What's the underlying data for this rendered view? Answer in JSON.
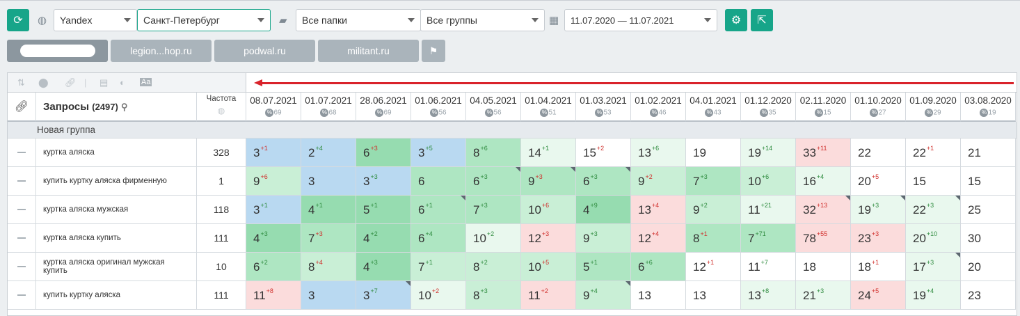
{
  "toolbar": {
    "engine": "Yandex",
    "region": "Санкт-Петербург",
    "folders": "Все папки",
    "groups": "Все группы",
    "date_range": "11.07.2020 — 11.07.2021"
  },
  "tabs": [
    "legion...hop.ru",
    "podwal.ru",
    "militant.ru"
  ],
  "table": {
    "title": "Запросы",
    "count": "(2497)",
    "freq_header": "Частота",
    "group_name": "Новая группа",
    "dates": [
      {
        "date": "08.07.2021",
        "pct": "69"
      },
      {
        "date": "01.07.2021",
        "pct": "68"
      },
      {
        "date": "28.06.2021",
        "pct": "69"
      },
      {
        "date": "01.06.2021",
        "pct": "56"
      },
      {
        "date": "04.05.2021",
        "pct": "56"
      },
      {
        "date": "01.04.2021",
        "pct": "51"
      },
      {
        "date": "01.03.2021",
        "pct": "53"
      },
      {
        "date": "01.02.2021",
        "pct": "46"
      },
      {
        "date": "04.01.2021",
        "pct": "43"
      },
      {
        "date": "01.12.2020",
        "pct": "35"
      },
      {
        "date": "02.11.2020",
        "pct": "15"
      },
      {
        "date": "01.10.2020",
        "pct": "27"
      },
      {
        "date": "01.09.2020",
        "pct": "29"
      },
      {
        "date": "03.08.2020",
        "pct": "19"
      }
    ],
    "rows": [
      {
        "query": "куртка аляска",
        "freq": "328",
        "cells": [
          {
            "v": "3",
            "d": "+1",
            "t": "dn",
            "bg": "#b9d9f1"
          },
          {
            "v": "2",
            "d": "+4",
            "t": "up",
            "bg": "#b9d9f1"
          },
          {
            "v": "6",
            "d": "+3",
            "t": "dn",
            "bg": "#96dcb0"
          },
          {
            "v": "3",
            "d": "+5",
            "t": "up",
            "bg": "#b9d9f1"
          },
          {
            "v": "8",
            "d": "+6",
            "t": "up",
            "bg": "#aee6c2"
          },
          {
            "v": "14",
            "d": "+1",
            "t": "up",
            "bg": "#e9f8ee"
          },
          {
            "v": "15",
            "d": "+2",
            "t": "dn",
            "bg": "#ffffff"
          },
          {
            "v": "13",
            "d": "+6",
            "t": "up",
            "bg": "#e9f8ee"
          },
          {
            "v": "19",
            "d": "",
            "t": "",
            "bg": "#ffffff"
          },
          {
            "v": "19",
            "d": "+14",
            "t": "up",
            "bg": "#e9f8ee"
          },
          {
            "v": "33",
            "d": "+11",
            "t": "dn",
            "bg": "#fbdcdc"
          },
          {
            "v": "22",
            "d": "",
            "t": "",
            "bg": "#ffffff"
          },
          {
            "v": "22",
            "d": "+1",
            "t": "dn",
            "bg": "#ffffff"
          },
          {
            "v": "21",
            "d": "",
            "t": "",
            "bg": "#ffffff"
          }
        ]
      },
      {
        "query": "купить куртку аляска фирменную",
        "freq": "1",
        "cells": [
          {
            "v": "9",
            "d": "+6",
            "t": "dn",
            "bg": "#c9efd6"
          },
          {
            "v": "3",
            "d": "",
            "t": "",
            "bg": "#b9d9f1"
          },
          {
            "v": "3",
            "d": "+3",
            "t": "up",
            "bg": "#b9d9f1"
          },
          {
            "v": "6",
            "d": "",
            "t": "",
            "bg": "#aee6c2"
          },
          {
            "v": "6",
            "d": "+3",
            "t": "up",
            "bg": "#aee6c2",
            "k": 1
          },
          {
            "v": "9",
            "d": "+3",
            "t": "dn",
            "bg": "#aee6c2",
            "k": 1
          },
          {
            "v": "6",
            "d": "+3",
            "t": "up",
            "bg": "#aee6c2",
            "k": 1
          },
          {
            "v": "9",
            "d": "+2",
            "t": "dn",
            "bg": "#c9efd6"
          },
          {
            "v": "7",
            "d": "+3",
            "t": "up",
            "bg": "#aee6c2"
          },
          {
            "v": "10",
            "d": "+6",
            "t": "up",
            "bg": "#c9efd6"
          },
          {
            "v": "16",
            "d": "+4",
            "t": "up",
            "bg": "#e9f8ee"
          },
          {
            "v": "20",
            "d": "+5",
            "t": "dn",
            "bg": "#ffffff"
          },
          {
            "v": "15",
            "d": "",
            "t": "",
            "bg": "#ffffff"
          },
          {
            "v": "15",
            "d": "",
            "t": "",
            "bg": "#ffffff"
          }
        ]
      },
      {
        "query": "куртка аляска мужская",
        "freq": "118",
        "cells": [
          {
            "v": "3",
            "d": "+1",
            "t": "up",
            "bg": "#b9d9f1"
          },
          {
            "v": "4",
            "d": "+1",
            "t": "up",
            "bg": "#96dcb0"
          },
          {
            "v": "5",
            "d": "+1",
            "t": "up",
            "bg": "#96dcb0"
          },
          {
            "v": "6",
            "d": "+1",
            "t": "up",
            "bg": "#aee6c2",
            "k": 1
          },
          {
            "v": "7",
            "d": "+3",
            "t": "up",
            "bg": "#aee6c2"
          },
          {
            "v": "10",
            "d": "+6",
            "t": "dn",
            "bg": "#c9efd6"
          },
          {
            "v": "4",
            "d": "+9",
            "t": "up",
            "bg": "#96dcb0"
          },
          {
            "v": "13",
            "d": "+4",
            "t": "dn",
            "bg": "#fbdcdc"
          },
          {
            "v": "9",
            "d": "+2",
            "t": "up",
            "bg": "#c9efd6"
          },
          {
            "v": "11",
            "d": "+21",
            "t": "up",
            "bg": "#e9f8ee"
          },
          {
            "v": "32",
            "d": "+13",
            "t": "dn",
            "bg": "#fbdcdc",
            "k": 1
          },
          {
            "v": "19",
            "d": "+3",
            "t": "up",
            "bg": "#e9f8ee",
            "k": 1
          },
          {
            "v": "22",
            "d": "+3",
            "t": "up",
            "bg": "#e9f8ee",
            "k": 1
          },
          {
            "v": "25",
            "d": "",
            "t": "",
            "bg": "#ffffff"
          }
        ]
      },
      {
        "query": "куртка аляска купить",
        "freq": "111",
        "cells": [
          {
            "v": "4",
            "d": "+3",
            "t": "up",
            "bg": "#96dcb0"
          },
          {
            "v": "7",
            "d": "+3",
            "t": "dn",
            "bg": "#aee6c2"
          },
          {
            "v": "4",
            "d": "+2",
            "t": "up",
            "bg": "#96dcb0"
          },
          {
            "v": "6",
            "d": "+4",
            "t": "up",
            "bg": "#aee6c2"
          },
          {
            "v": "10",
            "d": "+2",
            "t": "up",
            "bg": "#e9f8ee"
          },
          {
            "v": "12",
            "d": "+3",
            "t": "dn",
            "bg": "#fbdcdc"
          },
          {
            "v": "9",
            "d": "+3",
            "t": "up",
            "bg": "#c9efd6"
          },
          {
            "v": "12",
            "d": "+4",
            "t": "dn",
            "bg": "#fbdcdc"
          },
          {
            "v": "8",
            "d": "+1",
            "t": "dn",
            "bg": "#aee6c2"
          },
          {
            "v": "7",
            "d": "+71",
            "t": "up",
            "bg": "#aee6c2"
          },
          {
            "v": "78",
            "d": "+55",
            "t": "dn",
            "bg": "#fbdcdc"
          },
          {
            "v": "23",
            "d": "+3",
            "t": "dn",
            "bg": "#fbdcdc"
          },
          {
            "v": "20",
            "d": "+10",
            "t": "up",
            "bg": "#e9f8ee"
          },
          {
            "v": "30",
            "d": "",
            "t": "",
            "bg": "#ffffff"
          }
        ]
      },
      {
        "query": "куртка аляска оригинал мужская купить",
        "freq": "10",
        "cells": [
          {
            "v": "6",
            "d": "+2",
            "t": "up",
            "bg": "#aee6c2"
          },
          {
            "v": "8",
            "d": "+4",
            "t": "dn",
            "bg": "#c9efd6"
          },
          {
            "v": "4",
            "d": "+3",
            "t": "up",
            "bg": "#96dcb0"
          },
          {
            "v": "7",
            "d": "+1",
            "t": "up",
            "bg": "#c9efd6"
          },
          {
            "v": "8",
            "d": "+2",
            "t": "up",
            "bg": "#c9efd6"
          },
          {
            "v": "10",
            "d": "+5",
            "t": "dn",
            "bg": "#c9efd6"
          },
          {
            "v": "5",
            "d": "+1",
            "t": "up",
            "bg": "#aee6c2"
          },
          {
            "v": "6",
            "d": "+6",
            "t": "up",
            "bg": "#aee6c2"
          },
          {
            "v": "12",
            "d": "+1",
            "t": "dn",
            "bg": "#ffffff"
          },
          {
            "v": "11",
            "d": "+7",
            "t": "up",
            "bg": "#ffffff"
          },
          {
            "v": "18",
            "d": "",
            "t": "",
            "bg": "#ffffff"
          },
          {
            "v": "18",
            "d": "+1",
            "t": "dn",
            "bg": "#ffffff"
          },
          {
            "v": "17",
            "d": "+3",
            "t": "up",
            "bg": "#e9f8ee",
            "k": 1
          },
          {
            "v": "20",
            "d": "",
            "t": "",
            "bg": "#ffffff"
          }
        ]
      },
      {
        "query": "купить куртку аляска",
        "freq": "111",
        "cells": [
          {
            "v": "11",
            "d": "+8",
            "t": "dn",
            "bg": "#fbdcdc"
          },
          {
            "v": "3",
            "d": "",
            "t": "",
            "bg": "#b9d9f1"
          },
          {
            "v": "3",
            "d": "+7",
            "t": "up",
            "bg": "#b9d9f1",
            "k": 1
          },
          {
            "v": "10",
            "d": "+2",
            "t": "dn",
            "bg": "#e9f8ee"
          },
          {
            "v": "8",
            "d": "+3",
            "t": "up",
            "bg": "#c9efd6"
          },
          {
            "v": "11",
            "d": "+2",
            "t": "dn",
            "bg": "#fbdcdc"
          },
          {
            "v": "9",
            "d": "+4",
            "t": "up",
            "bg": "#c9efd6",
            "k": 1
          },
          {
            "v": "13",
            "d": "",
            "t": "",
            "bg": "#ffffff"
          },
          {
            "v": "13",
            "d": "",
            "t": "",
            "bg": "#ffffff"
          },
          {
            "v": "13",
            "d": "+8",
            "t": "up",
            "bg": "#e9f8ee"
          },
          {
            "v": "21",
            "d": "+3",
            "t": "up",
            "bg": "#e9f8ee"
          },
          {
            "v": "24",
            "d": "+5",
            "t": "dn",
            "bg": "#fbdcdc"
          },
          {
            "v": "19",
            "d": "+4",
            "t": "up",
            "bg": "#e9f8ee"
          },
          {
            "v": "23",
            "d": "",
            "t": "",
            "bg": "#ffffff"
          }
        ]
      }
    ]
  }
}
